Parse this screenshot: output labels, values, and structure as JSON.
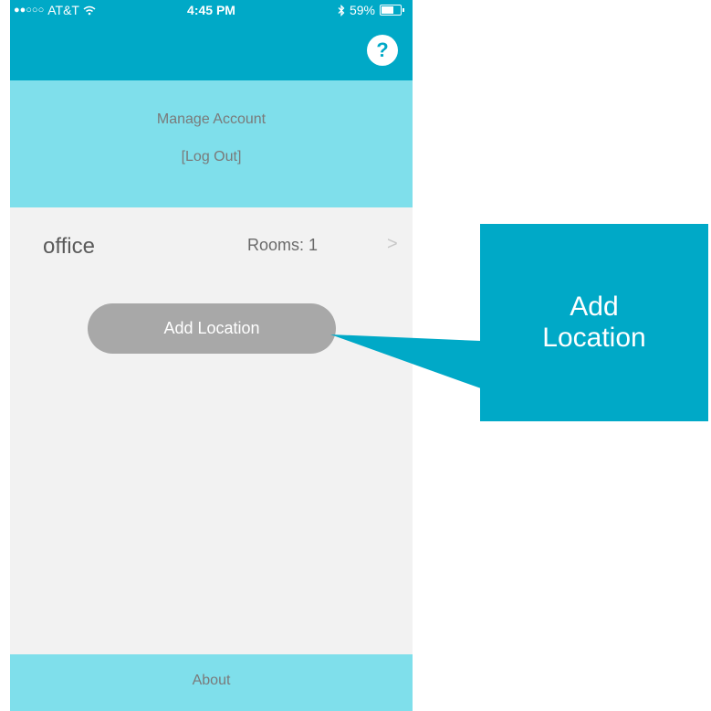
{
  "status_bar": {
    "signal": "●●○○○",
    "carrier": "AT&T",
    "time": "4:45 PM",
    "battery": "59%"
  },
  "nav": {
    "help_label": "?"
  },
  "account": {
    "manage_label": "Manage Account",
    "logout_label": "[Log Out]"
  },
  "location": {
    "name": "office",
    "rooms": "Rooms: 1",
    "chevron": ">"
  },
  "actions": {
    "add_location_label": "Add Location"
  },
  "footer": {
    "about_label": "About"
  },
  "callout": {
    "line1": "Add",
    "line2": "Location"
  },
  "colors": {
    "primary": "#00a9c7",
    "light": "#7fdfeb",
    "background": "#f2f2f2",
    "button": "#a8a8a8"
  }
}
